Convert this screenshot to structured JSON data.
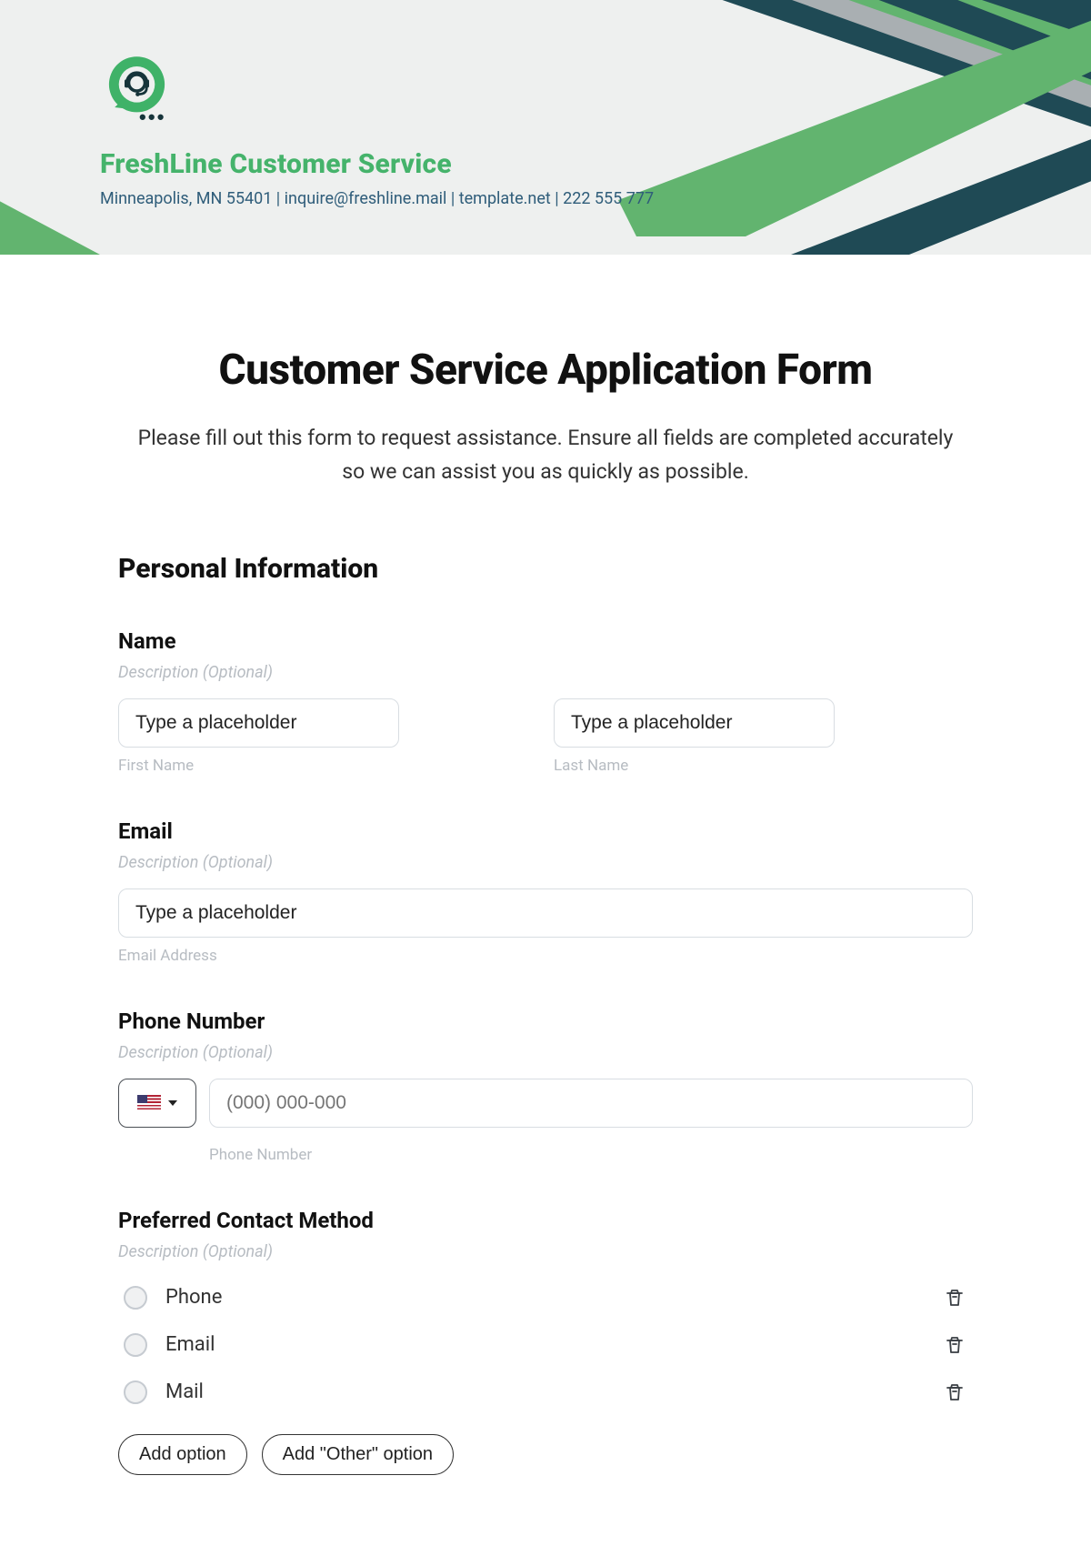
{
  "header": {
    "company_name": "FreshLine Customer Service",
    "subline": "Minneapolis, MN 55401 | inquire@freshline.mail | template.net | 222 555 777"
  },
  "page": {
    "title": "Customer Service Application Form",
    "intro": "Please fill out this form to request assistance. Ensure all fields are completed accurately so we can assist you as quickly as possible."
  },
  "section_personal": {
    "heading": "Personal Information"
  },
  "name": {
    "label": "Name",
    "desc": "Description (Optional)",
    "first_placeholder": "Type a placeholder",
    "last_placeholder": "Type a placeholder",
    "first_sub": "First Name",
    "last_sub": "Last Name"
  },
  "email": {
    "label": "Email",
    "desc": "Description (Optional)",
    "placeholder": "Type a placeholder",
    "sub": "Email Address"
  },
  "phone": {
    "label": "Phone Number",
    "desc": "Description (Optional)",
    "placeholder": "(000) 000-000",
    "sub": "Phone Number"
  },
  "contact_method": {
    "label": "Preferred Contact Method",
    "desc": "Description (Optional)",
    "options": [
      "Phone",
      "Email",
      "Mail"
    ],
    "add_option": "Add option",
    "add_other": "Add \"Other\" option"
  }
}
